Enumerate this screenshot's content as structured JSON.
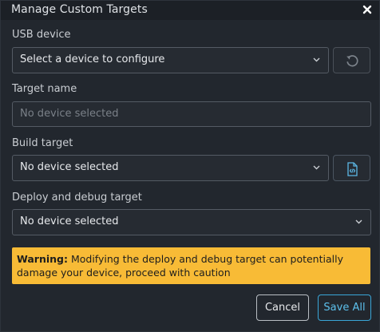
{
  "dialog": {
    "title": "Manage Custom Targets",
    "close_icon": "close-icon"
  },
  "usb_device": {
    "label": "USB device",
    "selected": "Select a device to configure",
    "refresh_icon": "refresh-icon"
  },
  "target_name": {
    "label": "Target name",
    "placeholder": "No device selected"
  },
  "build_target": {
    "label": "Build target",
    "selected": "No device selected",
    "code_icon": "code-file-icon"
  },
  "deploy_target": {
    "label": "Deploy and debug target",
    "selected": "No device selected"
  },
  "warning": {
    "prefix": "Warning:",
    "message": " Modifying the deploy and debug target can potentially damage your device, proceed with caution",
    "background_color": "#f8bb36"
  },
  "actions": {
    "cancel_label": "Cancel",
    "save_label": "Save All",
    "accent_color": "#3aa6d8"
  }
}
